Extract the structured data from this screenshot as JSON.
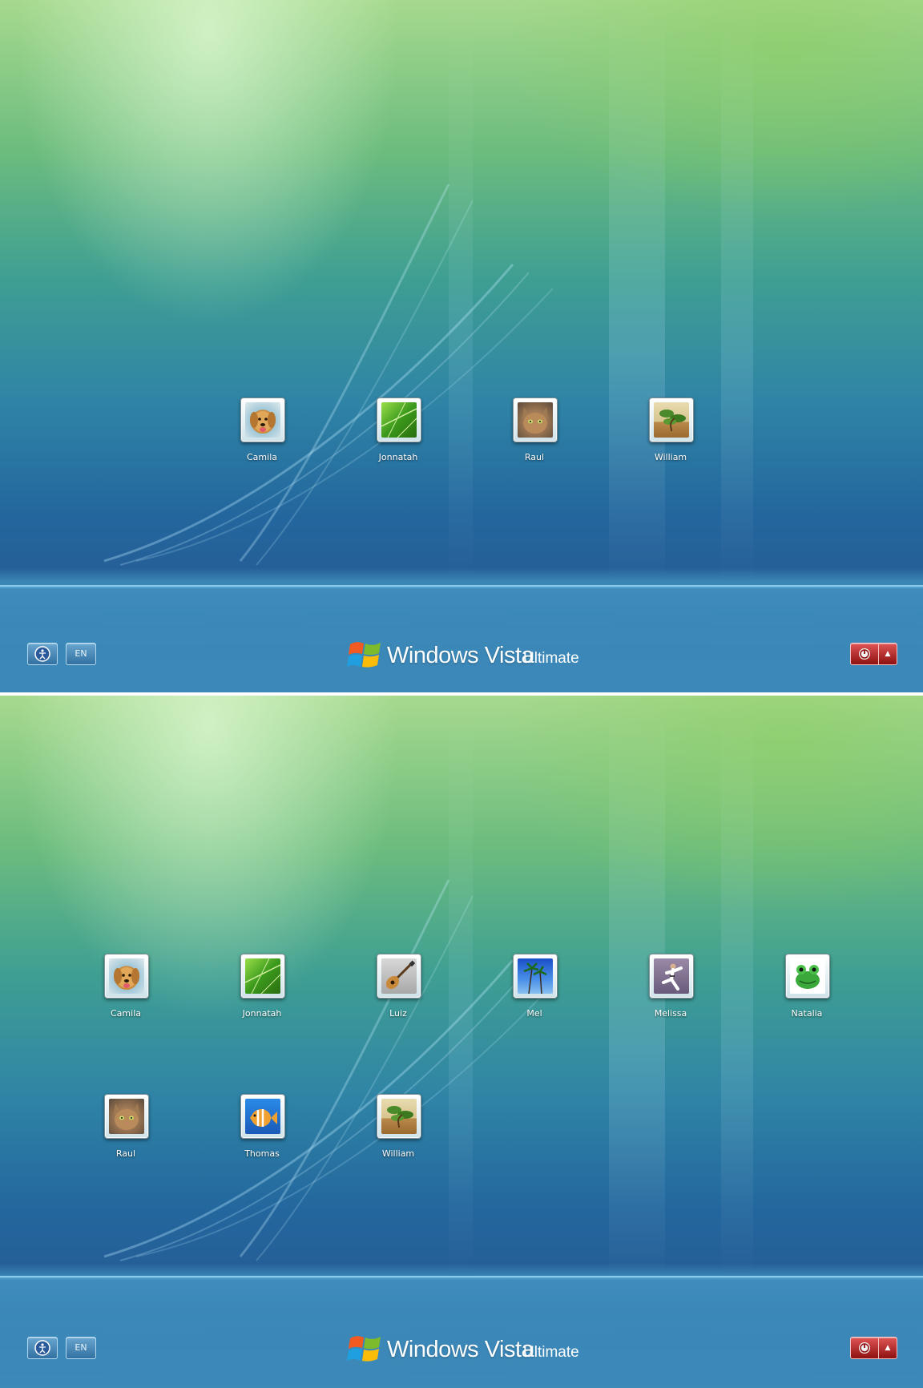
{
  "top_screen": {
    "users": [
      {
        "name": "Camila",
        "picture": "dog"
      },
      {
        "name": "Jonnatah",
        "picture": "green-leaf"
      },
      {
        "name": "Raul",
        "picture": "kitten"
      },
      {
        "name": "William",
        "picture": "bonsai"
      }
    ],
    "language": "EN",
    "brand": {
      "product": "Windows Vista",
      "edition": "Ultimate"
    }
  },
  "bottom_screen": {
    "users": [
      {
        "name": "Camila",
        "picture": "dog"
      },
      {
        "name": "Jonnatah",
        "picture": "green-leaf"
      },
      {
        "name": "Luiz",
        "picture": "guitar"
      },
      {
        "name": "Mel",
        "picture": "palm-trees"
      },
      {
        "name": "Melissa",
        "picture": "karate"
      },
      {
        "name": "Natalia",
        "picture": "frog"
      },
      {
        "name": "Raul",
        "picture": "kitten"
      },
      {
        "name": "Thomas",
        "picture": "fish"
      },
      {
        "name": "William",
        "picture": "bonsai"
      }
    ],
    "language": "EN",
    "brand": {
      "product": "Windows Vista",
      "edition": "Ultimate"
    }
  },
  "icons": {
    "ease_of_access": "ease-of-access-icon",
    "power": "power-icon",
    "shutdown_options": "chevron-up-icon",
    "logo": "windows-flag-logo"
  },
  "colors": {
    "power_button": "#b01c1c",
    "background_top": "#a6d98e",
    "background_bottom": "#255f98"
  }
}
